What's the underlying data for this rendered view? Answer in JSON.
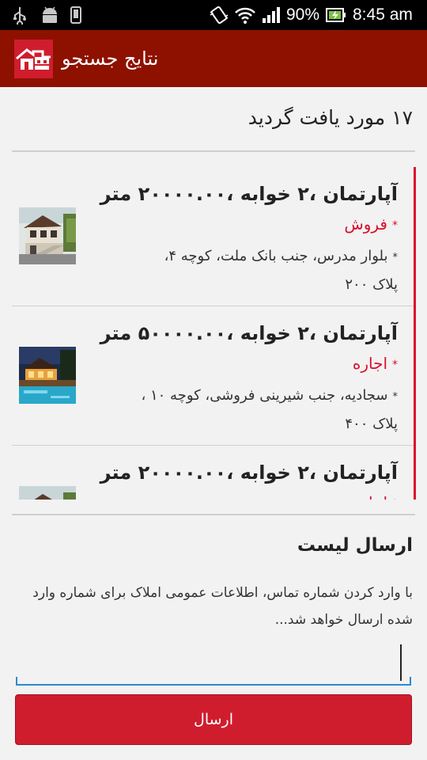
{
  "status_bar": {
    "battery": "90%",
    "time": "8:45 am"
  },
  "action_bar": {
    "title": "نتایج جستجو"
  },
  "results": {
    "count_text": "۱۷ مورد یافت گردید"
  },
  "listings": [
    {
      "title": "آپارتمان ،۲ خوابه ،۲۰۰۰۰.۰۰ متر",
      "type": "فروش",
      "address_line1": "بلوار مدرس، جنب بانک ملت، کوچه ۴،",
      "address_line2": "پلاک ۲۰۰"
    },
    {
      "title": "آپارتمان ،۲ خوابه ،۵۰۰۰۰.۰۰ متر",
      "type": "اجاره",
      "address_line1": "سجادیه، جنب شیرینی فروشی، کوچه ۱۰ ،",
      "address_line2": "پلاک ۴۰۰"
    },
    {
      "title": "آپارتمان ،۲ خوابه ،۲۰۰۰۰.۰۰ متر",
      "type": "اجاره",
      "address_line1": "",
      "address_line2": ""
    }
  ],
  "send_list": {
    "title": "ارسال لیست",
    "description": "با وارد کردن شماره تماس، اطلاعات عمومی املاک برای شماره وارد شده ارسال خواهد شد...",
    "phone_value": "",
    "button_label": "ارسال"
  },
  "colors": {
    "action_bar": "#8e1100",
    "accent": "#cf1d2e",
    "field_line": "#2b8ad3"
  }
}
